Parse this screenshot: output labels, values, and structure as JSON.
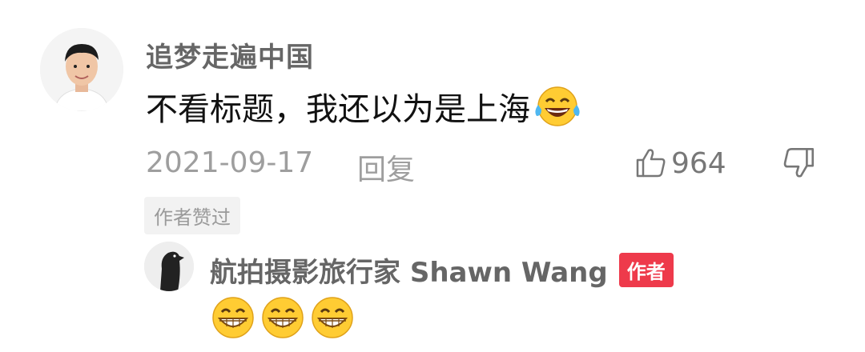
{
  "comment": {
    "username": "追梦走遍中国",
    "text": "不看标题，我还以为是上海",
    "emoji": "laughing-tears-emoji",
    "date": "2021-09-17",
    "reply_label": "回复",
    "like_count": "964",
    "author_liked_tag": "作者赞过"
  },
  "author_reply": {
    "username": "航拍摄影旅行家 Shawn Wang",
    "badge": "作者",
    "emojis": [
      "grin-emoji",
      "grin-emoji",
      "grin-emoji"
    ]
  },
  "colors": {
    "badge_bg": "#ee3a4b",
    "muted_text": "#9e9e9e",
    "username_text": "#666666"
  }
}
